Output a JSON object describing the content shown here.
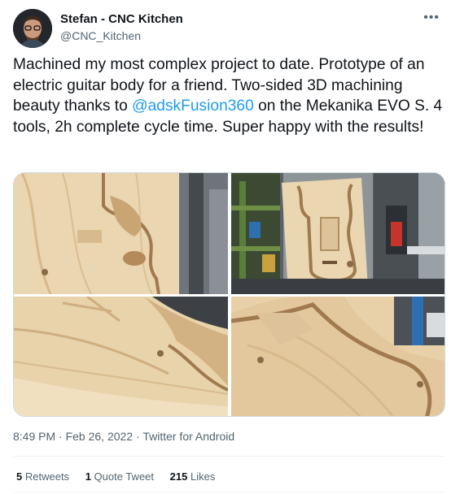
{
  "author": {
    "display_name": "Stefan - CNC Kitchen",
    "handle": "@CNC_Kitchen"
  },
  "tweet": {
    "text_before": "Machined my most complex project to date. Prototype of an electric guitar body for a friend. Two-sided 3D machining beauty thanks to ",
    "mention": "@adskFusion360",
    "text_after": " on the Mekanika EVO S. 4 tools, 2h complete cycle time. Super happy with the results!"
  },
  "meta": {
    "time": "8:49 PM",
    "separator1": " · ",
    "date": "Feb 26, 2022",
    "separator2": " · ",
    "source": "Twitter for Android"
  },
  "stats": {
    "retweets_count": "5",
    "retweets_label": "Retweets",
    "quotes_count": "1",
    "quotes_label": "Quote Tweet",
    "likes_count": "215",
    "likes_label": "Likes"
  }
}
